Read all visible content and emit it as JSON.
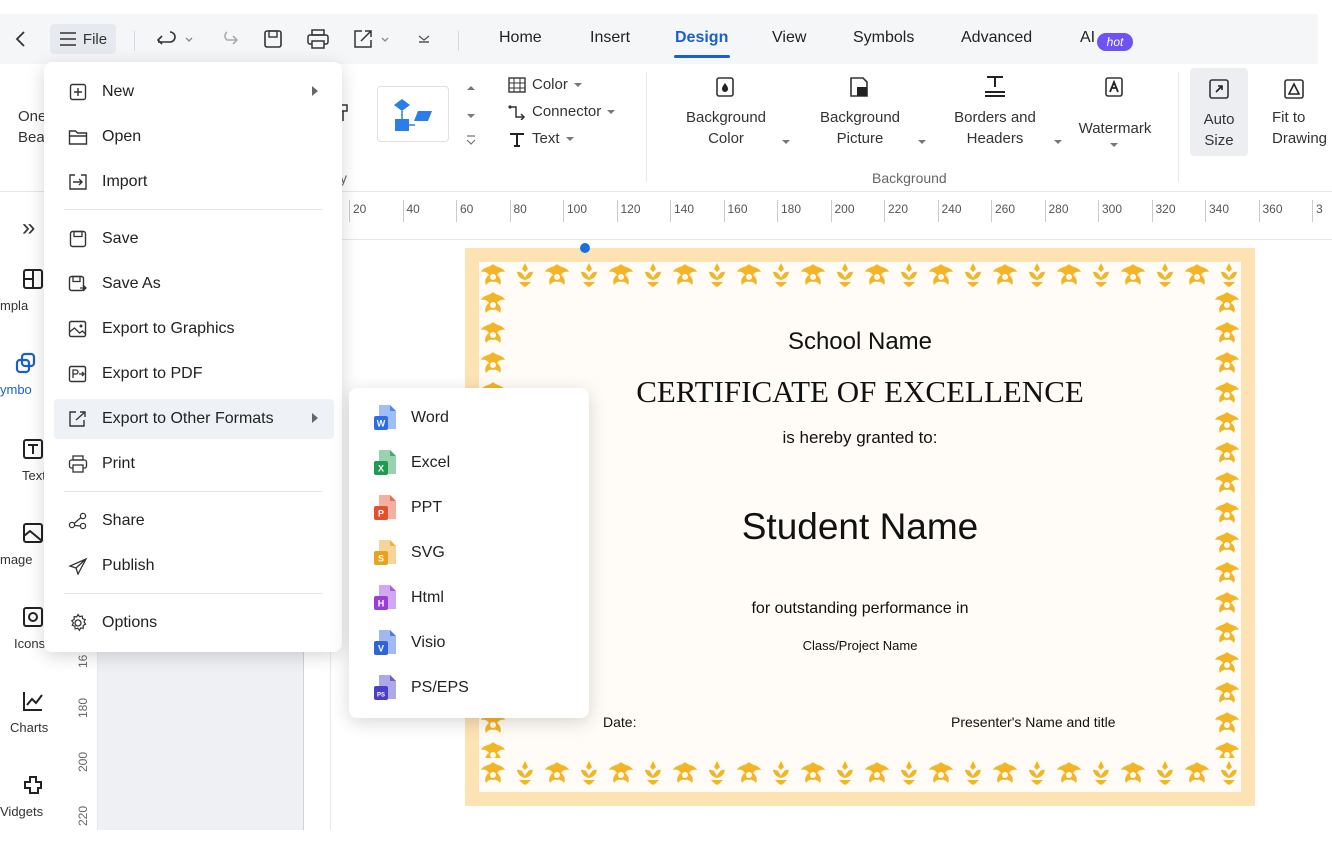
{
  "topbar": {
    "file_label": "File",
    "tabs": [
      {
        "label": "Home"
      },
      {
        "label": "Insert"
      },
      {
        "label": "Design"
      },
      {
        "label": "View"
      },
      {
        "label": "Symbols"
      },
      {
        "label": "Advanced"
      },
      {
        "label": "AI"
      }
    ],
    "active_tab": "Design",
    "hot_badge": "hot"
  },
  "ribbon": {
    "left_partial": {
      "line1": "One",
      "line2": "Bea"
    },
    "color_label": "Color",
    "connector_label": "Connector",
    "text_label": "Text",
    "background_color": {
      "line1": "Background",
      "line2": "Color"
    },
    "background_picture": {
      "line1": "Background",
      "line2": "Picture"
    },
    "borders_headers": {
      "line1": "Borders and",
      "line2": "Headers"
    },
    "watermark": "Watermark",
    "auto_size": {
      "line1": "Auto",
      "line2": "Size"
    },
    "fit_to_drawing": {
      "line1": "Fit to",
      "line2": "Drawing"
    },
    "group_background": "Background",
    "group_partial": "y"
  },
  "ruler": {
    "ticks": [
      "20",
      "40",
      "60",
      "80",
      "100",
      "120",
      "140",
      "160",
      "180",
      "200",
      "220",
      "240",
      "260",
      "280",
      "300",
      "320",
      "340",
      "360",
      "3"
    ],
    "vertical_ticks": [
      "16",
      "180",
      "200",
      "220"
    ]
  },
  "leftrail": {
    "expand_glyph": "»",
    "items": [
      {
        "label": "mpla",
        "icon": "templates-icon"
      },
      {
        "label": "ymbo",
        "icon": "symbols-icon"
      },
      {
        "label": "Text",
        "icon": "text-icon"
      },
      {
        "label": "mage",
        "icon": "image-icon"
      },
      {
        "label": "Icons",
        "icon": "icons-icon"
      },
      {
        "label": "Charts",
        "icon": "charts-icon"
      },
      {
        "label": "Vidgets",
        "icon": "widgets-icon"
      }
    ]
  },
  "file_menu": {
    "items": [
      {
        "label": "New",
        "icon": "plus-box-icon",
        "submenu": true
      },
      {
        "label": "Open",
        "icon": "folder-icon"
      },
      {
        "label": "Import",
        "icon": "import-icon"
      },
      {
        "label": "Save",
        "icon": "save-icon"
      },
      {
        "label": "Save As",
        "icon": "save-as-icon"
      },
      {
        "label": "Export to Graphics",
        "icon": "export-graphics-icon"
      },
      {
        "label": "Export to PDF",
        "icon": "export-pdf-icon"
      },
      {
        "label": "Export to Other Formats",
        "icon": "export-other-icon",
        "submenu": true
      },
      {
        "label": "Print",
        "icon": "print-icon"
      },
      {
        "label": "Share",
        "icon": "share-icon"
      },
      {
        "label": "Publish",
        "icon": "publish-icon"
      },
      {
        "label": "Options",
        "icon": "gear-icon"
      }
    ]
  },
  "export_submenu": {
    "items": [
      {
        "label": "Word",
        "badge": "W",
        "color": "#2b6fe8"
      },
      {
        "label": "Excel",
        "badge": "X",
        "color": "#1f9a4f"
      },
      {
        "label": "PPT",
        "badge": "P",
        "color": "#e2512c"
      },
      {
        "label": "SVG",
        "badge": "S",
        "color": "#e8a21b"
      },
      {
        "label": "Html",
        "badge": "H",
        "color": "#9a3fd6"
      },
      {
        "label": "Visio",
        "badge": "V",
        "color": "#2e63d9"
      },
      {
        "label": "PS/EPS",
        "badge": "PS",
        "color": "#4b3fc7"
      }
    ]
  },
  "certificate": {
    "school_name": "School Name",
    "title": "CERTIFICATE OF EXCELLENCE",
    "granted": "is hereby granted to:",
    "student_name": "Student Name",
    "performance": "for outstanding performance in",
    "class_name": "Class/Project Name",
    "date_label": "Date:",
    "presenter": "Presenter's Name and title",
    "border_color": "#fde2b4",
    "ornament_color": "#f2b526"
  }
}
